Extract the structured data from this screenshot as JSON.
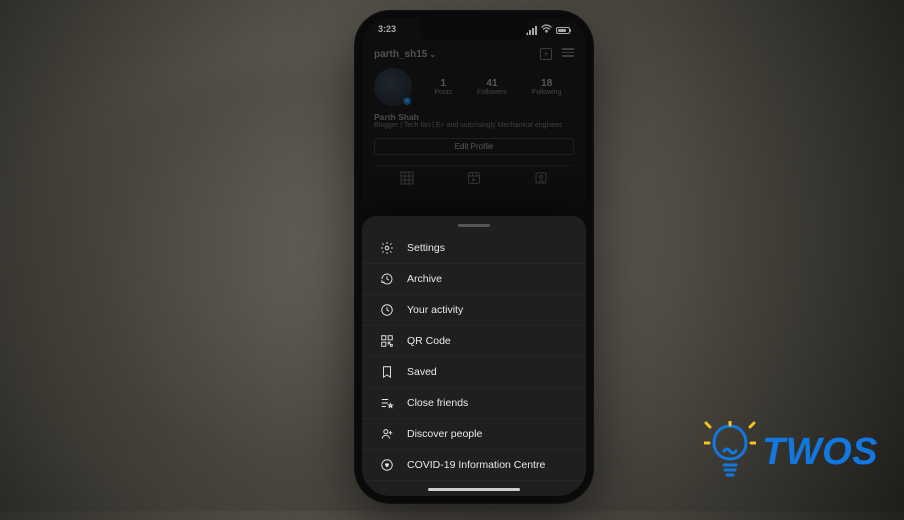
{
  "status": {
    "time": "3:23"
  },
  "profile": {
    "username": "parth_sh15",
    "display_name": "Parth Shah",
    "bio": "Blogger | Tech fan | E> and surprisingly Mechanical\nengineer.",
    "stats": [
      {
        "n": "1",
        "l": "Posts"
      },
      {
        "n": "41",
        "l": "Followers"
      },
      {
        "n": "18",
        "l": "Following"
      }
    ],
    "edit_button": "Edit Profile"
  },
  "sheet": {
    "items": [
      {
        "icon": "gear",
        "label": "Settings"
      },
      {
        "icon": "archive",
        "label": "Archive"
      },
      {
        "icon": "activity",
        "label": "Your activity"
      },
      {
        "icon": "qr",
        "label": "QR Code"
      },
      {
        "icon": "saved",
        "label": "Saved"
      },
      {
        "icon": "close-friends",
        "label": "Close friends"
      },
      {
        "icon": "discover",
        "label": "Discover people"
      },
      {
        "icon": "covid",
        "label": "COVID-19 Information Centre"
      }
    ]
  },
  "watermark": {
    "text": "TWOS"
  }
}
